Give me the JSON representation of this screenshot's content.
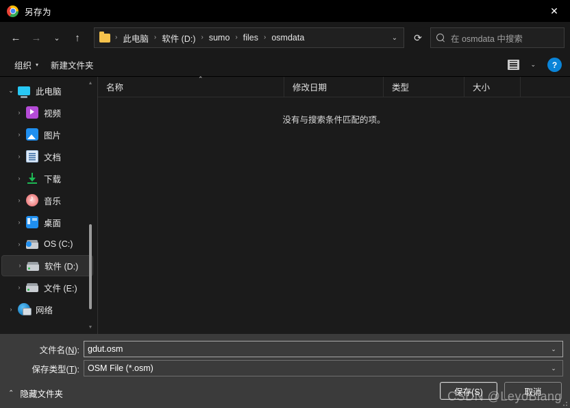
{
  "titlebar": {
    "app_icon": "chrome-logo-icon",
    "title": "另存为",
    "close_label": "✕"
  },
  "nav": {
    "back_icon": "←",
    "forward_icon": "→",
    "recent_icon": "⌄",
    "up_icon": "↑",
    "refresh_icon": "⟳",
    "breadcrumb_chevron": "⌄",
    "breadcrumb": [
      {
        "label": "此电脑"
      },
      {
        "label": "软件 (D:)"
      },
      {
        "label": "sumo"
      },
      {
        "label": "files"
      },
      {
        "label": "osmdata"
      }
    ],
    "separator": "›"
  },
  "search": {
    "placeholder": "在 osmdata 中搜索",
    "icon": "search-icon"
  },
  "commandbar": {
    "organize_label": "组织",
    "organize_caret": "▾",
    "new_folder_label": "新建文件夹",
    "view_caret": "⌄",
    "help_label": "?"
  },
  "sidebar": {
    "items": [
      {
        "label": "此电脑",
        "icon": "computer-icon",
        "expander": "⌄",
        "level": 0,
        "selected": false
      },
      {
        "label": "视频",
        "icon": "video-icon",
        "expander": "›",
        "level": 1,
        "selected": false
      },
      {
        "label": "图片",
        "icon": "pictures-icon",
        "expander": "›",
        "level": 1,
        "selected": false
      },
      {
        "label": "文档",
        "icon": "documents-icon",
        "expander": "›",
        "level": 1,
        "selected": false
      },
      {
        "label": "下载",
        "icon": "downloads-icon",
        "expander": "›",
        "level": 1,
        "selected": false
      },
      {
        "label": "音乐",
        "icon": "music-icon",
        "expander": "›",
        "level": 1,
        "selected": false
      },
      {
        "label": "桌面",
        "icon": "desktop-icon",
        "expander": "›",
        "level": 1,
        "selected": false
      },
      {
        "label": "OS (C:)",
        "icon": "os-drive-icon",
        "expander": "›",
        "level": 1,
        "selected": false
      },
      {
        "label": "软件 (D:)",
        "icon": "drive-icon",
        "expander": "›",
        "level": 1,
        "selected": true
      },
      {
        "label": "文件 (E:)",
        "icon": "drive-icon",
        "expander": "›",
        "level": 1,
        "selected": false
      },
      {
        "label": "网络",
        "icon": "network-icon",
        "expander": "›",
        "level": 0,
        "selected": false
      }
    ],
    "scroll_up": "▲",
    "scroll_down": "▼"
  },
  "filelist": {
    "columns": [
      {
        "label": "名称"
      },
      {
        "label": "修改日期"
      },
      {
        "label": "类型"
      },
      {
        "label": "大小"
      }
    ],
    "sort_caret": "⌃",
    "empty_message": "没有与搜索条件匹配的项。"
  },
  "form": {
    "filename_label_pre": "文件名(",
    "filename_accesskey": "N",
    "filename_label_post": "):",
    "filename_value": "gdut.osm",
    "filetype_label_pre": "保存类型(",
    "filetype_accesskey": "T",
    "filetype_label_post": "):",
    "filetype_value": "OSM File (*.osm)",
    "dropdown_caret": "⌄"
  },
  "footer": {
    "hide_folders_caret": "⌃",
    "hide_folders_label": "隐藏文件夹",
    "save_label": "保存(S)",
    "cancel_label": "取消"
  },
  "watermark": {
    "text": "CSDN @LeyoBiang"
  }
}
